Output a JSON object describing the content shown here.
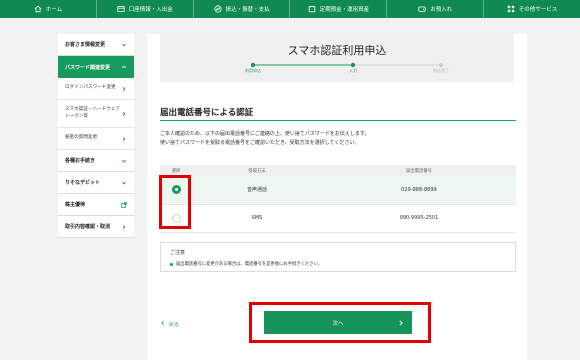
{
  "nav": {
    "items": [
      {
        "label": "ホーム",
        "icon": "home-icon"
      },
      {
        "label": "口座情報・入出金",
        "icon": "account-icon"
      },
      {
        "label": "振込・振替・支払",
        "icon": "transfer-icon"
      },
      {
        "label": "定期預金・運用資産",
        "icon": "deposit-icon"
      },
      {
        "label": "お預入れ",
        "icon": "wallet-icon"
      },
      {
        "label": "その他サービス",
        "icon": "grid-icon"
      }
    ]
  },
  "sidebar": {
    "items": [
      {
        "label": "お客さま情報変更"
      },
      {
        "label": "パスワード関連変更"
      },
      {
        "label": "ログインパスワード変更"
      },
      {
        "label": "スマホ認証・ハードウェア トークン等"
      },
      {
        "label": "秘密の質問変更"
      },
      {
        "label": "各種お手続き"
      },
      {
        "label": "りそなデビット"
      },
      {
        "label": "株主優待"
      },
      {
        "label": "取引内容確認・取消"
      }
    ]
  },
  "page": {
    "title": "スマホ認証利用申込",
    "steps": [
      "利用申込",
      "入力",
      "申込完了"
    ]
  },
  "section": {
    "title": "届出電話番号による認証",
    "description_line1": "ご本人確認のため、以下の届出電話番号にご連絡の上、使い捨てパスワードをお伝えします。",
    "description_line2": "使い捨てパスワードを受取る電話番号をご確認いただき、受取方法を選択してください。"
  },
  "table": {
    "headers": [
      "選択",
      "受取方法",
      "届出電話番号"
    ],
    "rows": [
      {
        "method": "音声通話",
        "phone": "029-888-8899",
        "selected": true
      },
      {
        "method": "SMS",
        "phone": "090-9995-2501",
        "selected": false
      }
    ]
  },
  "notes": {
    "title": "ご注意",
    "text": "届出電話番号に変更がある場合は、電話番号を変更後にお手続きください。"
  },
  "actions": {
    "back_label": "戻る",
    "next_label": "次へ"
  },
  "colors": {
    "brand_green": "#179a5e",
    "highlight_red": "#e00000"
  }
}
